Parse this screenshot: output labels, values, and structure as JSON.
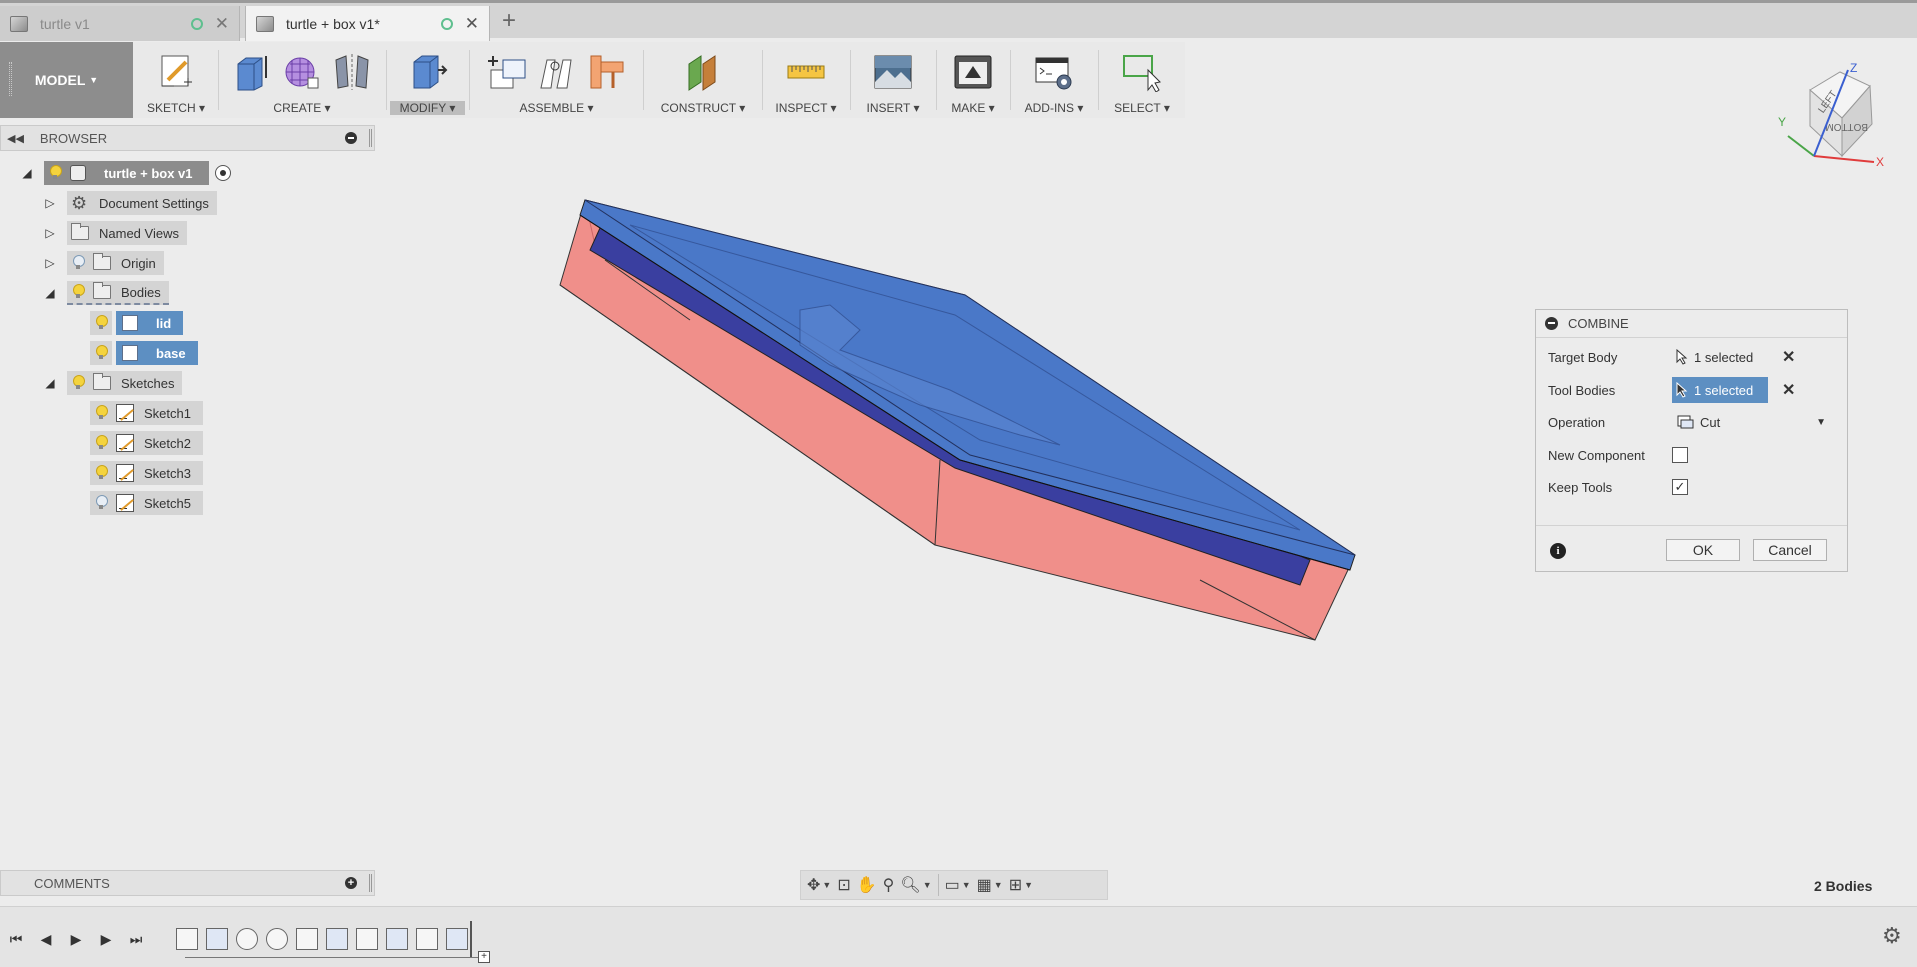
{
  "tabs": [
    {
      "title": "turtle v1",
      "active": false
    },
    {
      "title": "turtle + box v1*",
      "active": true
    }
  ],
  "toolbar": {
    "workspace_label": "MODEL",
    "groups": [
      {
        "label": "SKETCH",
        "icons": [
          "create-sketch-icon"
        ]
      },
      {
        "label": "CREATE",
        "icons": [
          "extrude-icon",
          "form-icon",
          "mirror-icon"
        ]
      },
      {
        "label": "MODIFY",
        "icons": [
          "press-pull-icon"
        ],
        "selected": true
      },
      {
        "label": "ASSEMBLE",
        "icons": [
          "new-component-icon",
          "joint-icon",
          "as-built-joint-icon"
        ]
      },
      {
        "label": "CONSTRUCT",
        "icons": [
          "offset-plane-icon"
        ]
      },
      {
        "label": "INSPECT",
        "icons": [
          "measure-icon"
        ]
      },
      {
        "label": "INSERT",
        "icons": [
          "insert-image-icon"
        ]
      },
      {
        "label": "MAKE",
        "icons": [
          "3d-print-icon"
        ]
      },
      {
        "label": "ADD-INS",
        "icons": [
          "scripts-addins-icon"
        ]
      },
      {
        "label": "SELECT",
        "icons": [
          "select-icon"
        ]
      }
    ]
  },
  "viewcube": {
    "faces": [
      "LEFT",
      "BOTTOM"
    ],
    "axes": [
      "X",
      "Y",
      "Z"
    ]
  },
  "browser": {
    "title": "BROWSER",
    "root": "turtle + box v1",
    "items": [
      {
        "label": "Document Settings"
      },
      {
        "label": "Named Views"
      },
      {
        "label": "Origin"
      },
      {
        "label": "Bodies"
      },
      {
        "label": "lid"
      },
      {
        "label": "base"
      },
      {
        "label": "Sketches"
      },
      {
        "label": "Sketch1"
      },
      {
        "label": "Sketch2"
      },
      {
        "label": "Sketch3"
      },
      {
        "label": "Sketch5"
      }
    ]
  },
  "combine": {
    "title": "COMBINE",
    "target_body_label": "Target Body",
    "target_body_value": "1 selected",
    "tool_bodies_label": "Tool Bodies",
    "tool_bodies_value": "1 selected",
    "operation_label": "Operation",
    "operation_value": "Cut",
    "new_component_label": "New Component",
    "new_component_checked": false,
    "keep_tools_label": "Keep Tools",
    "keep_tools_checked": true,
    "ok_label": "OK",
    "cancel_label": "Cancel"
  },
  "comments": {
    "title": "COMMENTS"
  },
  "status": {
    "body_count": "2 Bodies"
  },
  "colors": {
    "lid_blue": "#4a78c8",
    "base_salmon": "#f08f8a",
    "selection_blue": "#5d8fc2"
  }
}
